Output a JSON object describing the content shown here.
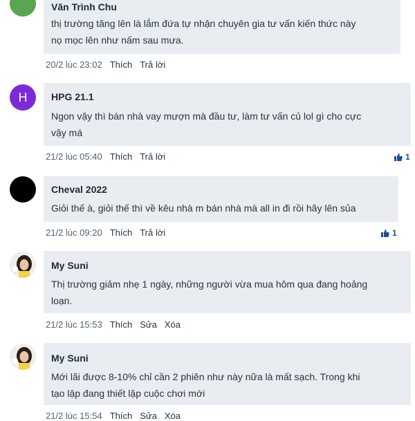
{
  "comments": [
    {
      "author": "Văn Trình Chu",
      "text_lines": [
        "thị trường tăng lên là lắm đứa tự nhận chuyên gia tư vấn kiến thức này",
        "nọ mọc lên như nấm sau mưa."
      ],
      "time": "20/2 lúc 23:02",
      "actions": [
        "Thích",
        "Trả lời"
      ],
      "likes": null,
      "avatar": "green-photo"
    },
    {
      "author": "HPG 21.1",
      "avatar_letter": "H",
      "text_lines": [
        "Ngon vậy thì bán nhà vay mượn mà đầu tư, làm tư vấn củ lol gì cho cực",
        "vậy má"
      ],
      "time": "21/2 lúc 05:40",
      "actions": [
        "Thích",
        "Trả lời"
      ],
      "likes": "1",
      "avatar": "letter"
    },
    {
      "author": "Cheval 2022",
      "text_lines": [
        "Giỏi thế à, giỏi thế thì về kêu nhà m bán nhà mà all in đi rồi hãy lên sủa"
      ],
      "time": "21/2 lúc 09:20",
      "actions": [
        "Thích",
        "Trả lời"
      ],
      "likes": "1",
      "avatar": "black"
    },
    {
      "author": "My Suni",
      "text_lines": [
        "Thị trường giảm nhẹ 1 ngày, những người vừa mua hôm qua đang hoảng",
        "loạn."
      ],
      "time": "21/2 lúc 15:53",
      "actions": [
        "Thích",
        "Sửa",
        "Xóa"
      ],
      "likes": null,
      "avatar": "photo"
    },
    {
      "author": "My Suni",
      "text_lines": [
        "Mới lãi được 8-10% chỉ cần 2 phiên như này nữa là mất sạch. Trong khi",
        "tạo lập đang thiết lập cuộc chơi mới"
      ],
      "time": "21/2 lúc 15:54",
      "actions": [
        "Thích",
        "Sửa",
        "Xóa"
      ],
      "likes": null,
      "avatar": "photo"
    }
  ],
  "colors": {
    "bubble_bg": "#e9edf1",
    "like_blue": "#1d4e8f",
    "avatar_purple": "#7b2bd6"
  },
  "icons": [
    "thumbs-up-icon"
  ]
}
